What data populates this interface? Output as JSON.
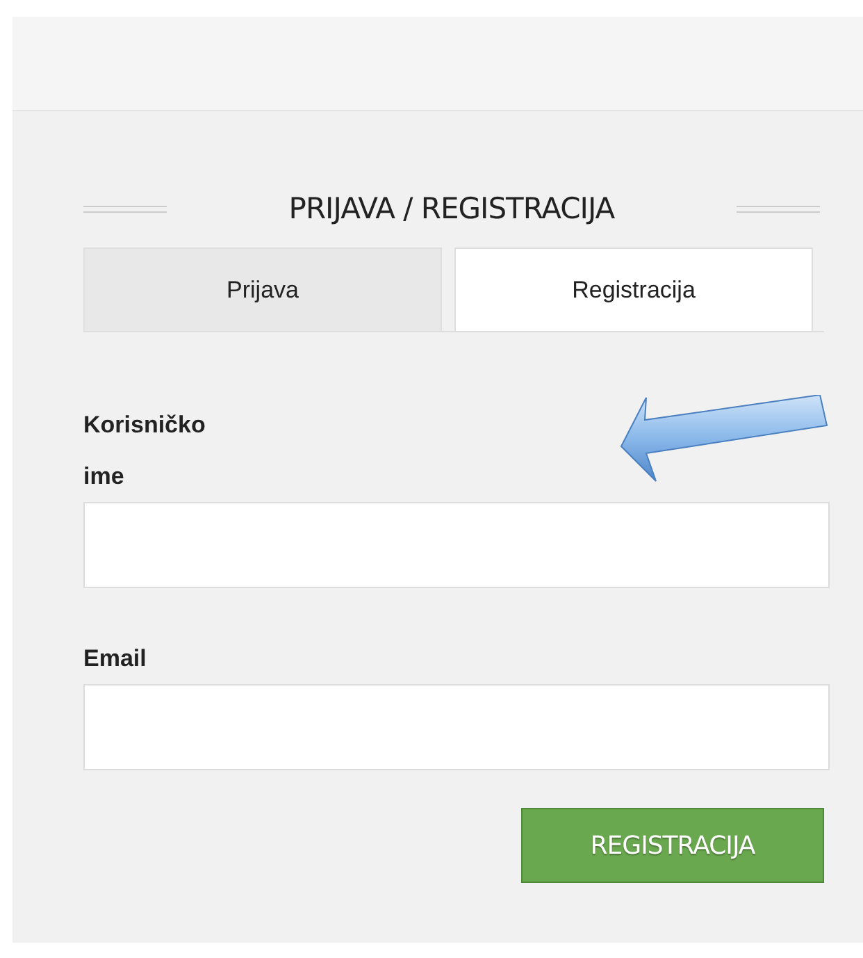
{
  "panel": {
    "title": "PRIJAVA / REGISTRACIJA"
  },
  "tabs": [
    {
      "label": "Prijava",
      "selected": false
    },
    {
      "label": "Registracija",
      "selected": true
    }
  ],
  "fields": [
    {
      "label": "Korisničko ime"
    },
    {
      "label": "Email"
    }
  ],
  "submit_button": "REGISTRACIJA"
}
